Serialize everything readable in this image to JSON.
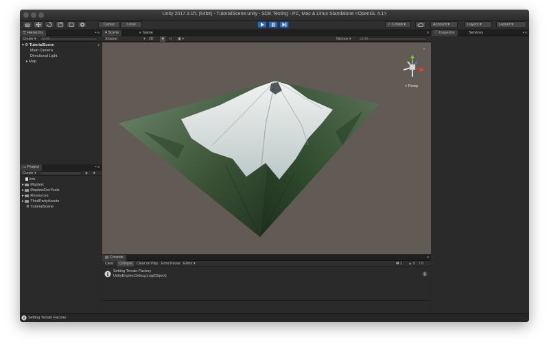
{
  "window": {
    "title": "Unity 2017.3.1f1 (64bit) - TutorialScene.unity - SDK Testing - PC, Mac & Linux Standalone <OpenGL 4.1>"
  },
  "toolbar": {
    "tools": [
      "hand-icon",
      "move-icon",
      "rotate-icon",
      "scale-icon",
      "rect-icon",
      "transform-icon"
    ],
    "pivot_label": "Center",
    "space_label": "Local",
    "collab_label": "Collab",
    "account_label": "Account",
    "layers_label": "Layers",
    "layout_label": "Layout",
    "accent": "#2f6ab4"
  },
  "hierarchy": {
    "tab": "Hierarchy",
    "create_label": "Create",
    "search_placeholder": "Q:All",
    "root": "TutorialScene",
    "items": [
      "Main Camera",
      "Directional Light",
      "Map"
    ]
  },
  "scene": {
    "tab_scene": "Scene",
    "tab_game": "Game",
    "shading": "Shaded",
    "mode_2d": "2D",
    "gizmos_label": "Gizmos",
    "search_placeholder": "Q:All",
    "persp_label": "< Persp",
    "background": "#615a55"
  },
  "inspector": {
    "tab_inspector": "Inspector",
    "tab_services": "Services"
  },
  "project": {
    "tab": "Project",
    "create_label": "Create",
    "items": [
      "link",
      "Mapbox",
      "MapboxDevTools",
      "Resources",
      "ThirdPartyAssets",
      "TutorialScene"
    ]
  },
  "console": {
    "tab": "Console",
    "buttons": [
      "Clear",
      "Collapse",
      "Clear on Play",
      "Error Pause",
      "Editor"
    ],
    "counts": {
      "info": "1",
      "warnings": "0",
      "errors": "0"
    },
    "message_line1": "Setting Terrain Factory",
    "message_line2": "UnityEngine.Debug:Log(Object)"
  },
  "status": {
    "message": "Setting Terrain Factory"
  }
}
